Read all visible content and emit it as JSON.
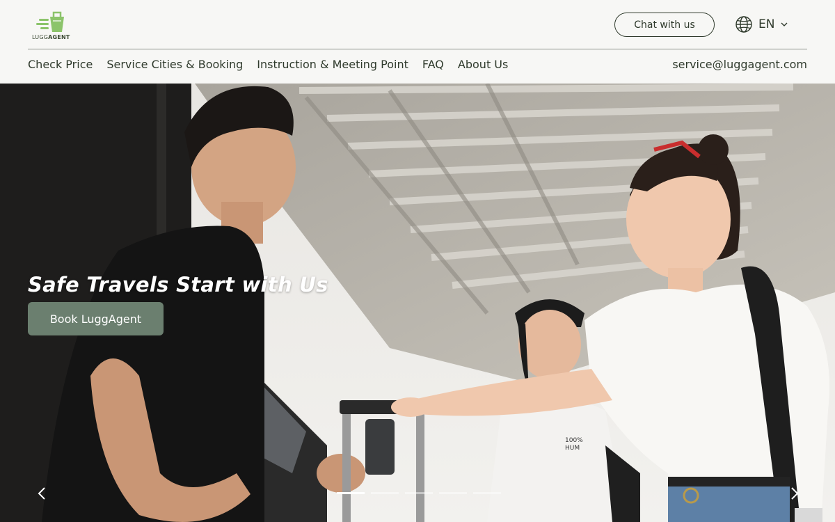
{
  "brand": {
    "logo_text_light": "LUGG",
    "logo_text_bold": "AGENT",
    "logo_color": "#8cc46b"
  },
  "header": {
    "chat_label": "Chat with us",
    "language": "EN",
    "language_icon": "globe-icon",
    "email": "service@luggagent.com"
  },
  "nav": {
    "items": [
      {
        "label": "Check Price"
      },
      {
        "label": "Service Cities & Booking"
      },
      {
        "label": "Instruction & Meeting Point"
      },
      {
        "label": "FAQ"
      },
      {
        "label": "About Us"
      }
    ]
  },
  "hero": {
    "title": "Safe Travels Start with Us",
    "cta_label": "Book LuggAgent",
    "cta_color": "#6b7f6f",
    "slide_count": 5,
    "active_slide": 0,
    "shirt_text_1": "100%",
    "shirt_text_2": "HUM"
  }
}
